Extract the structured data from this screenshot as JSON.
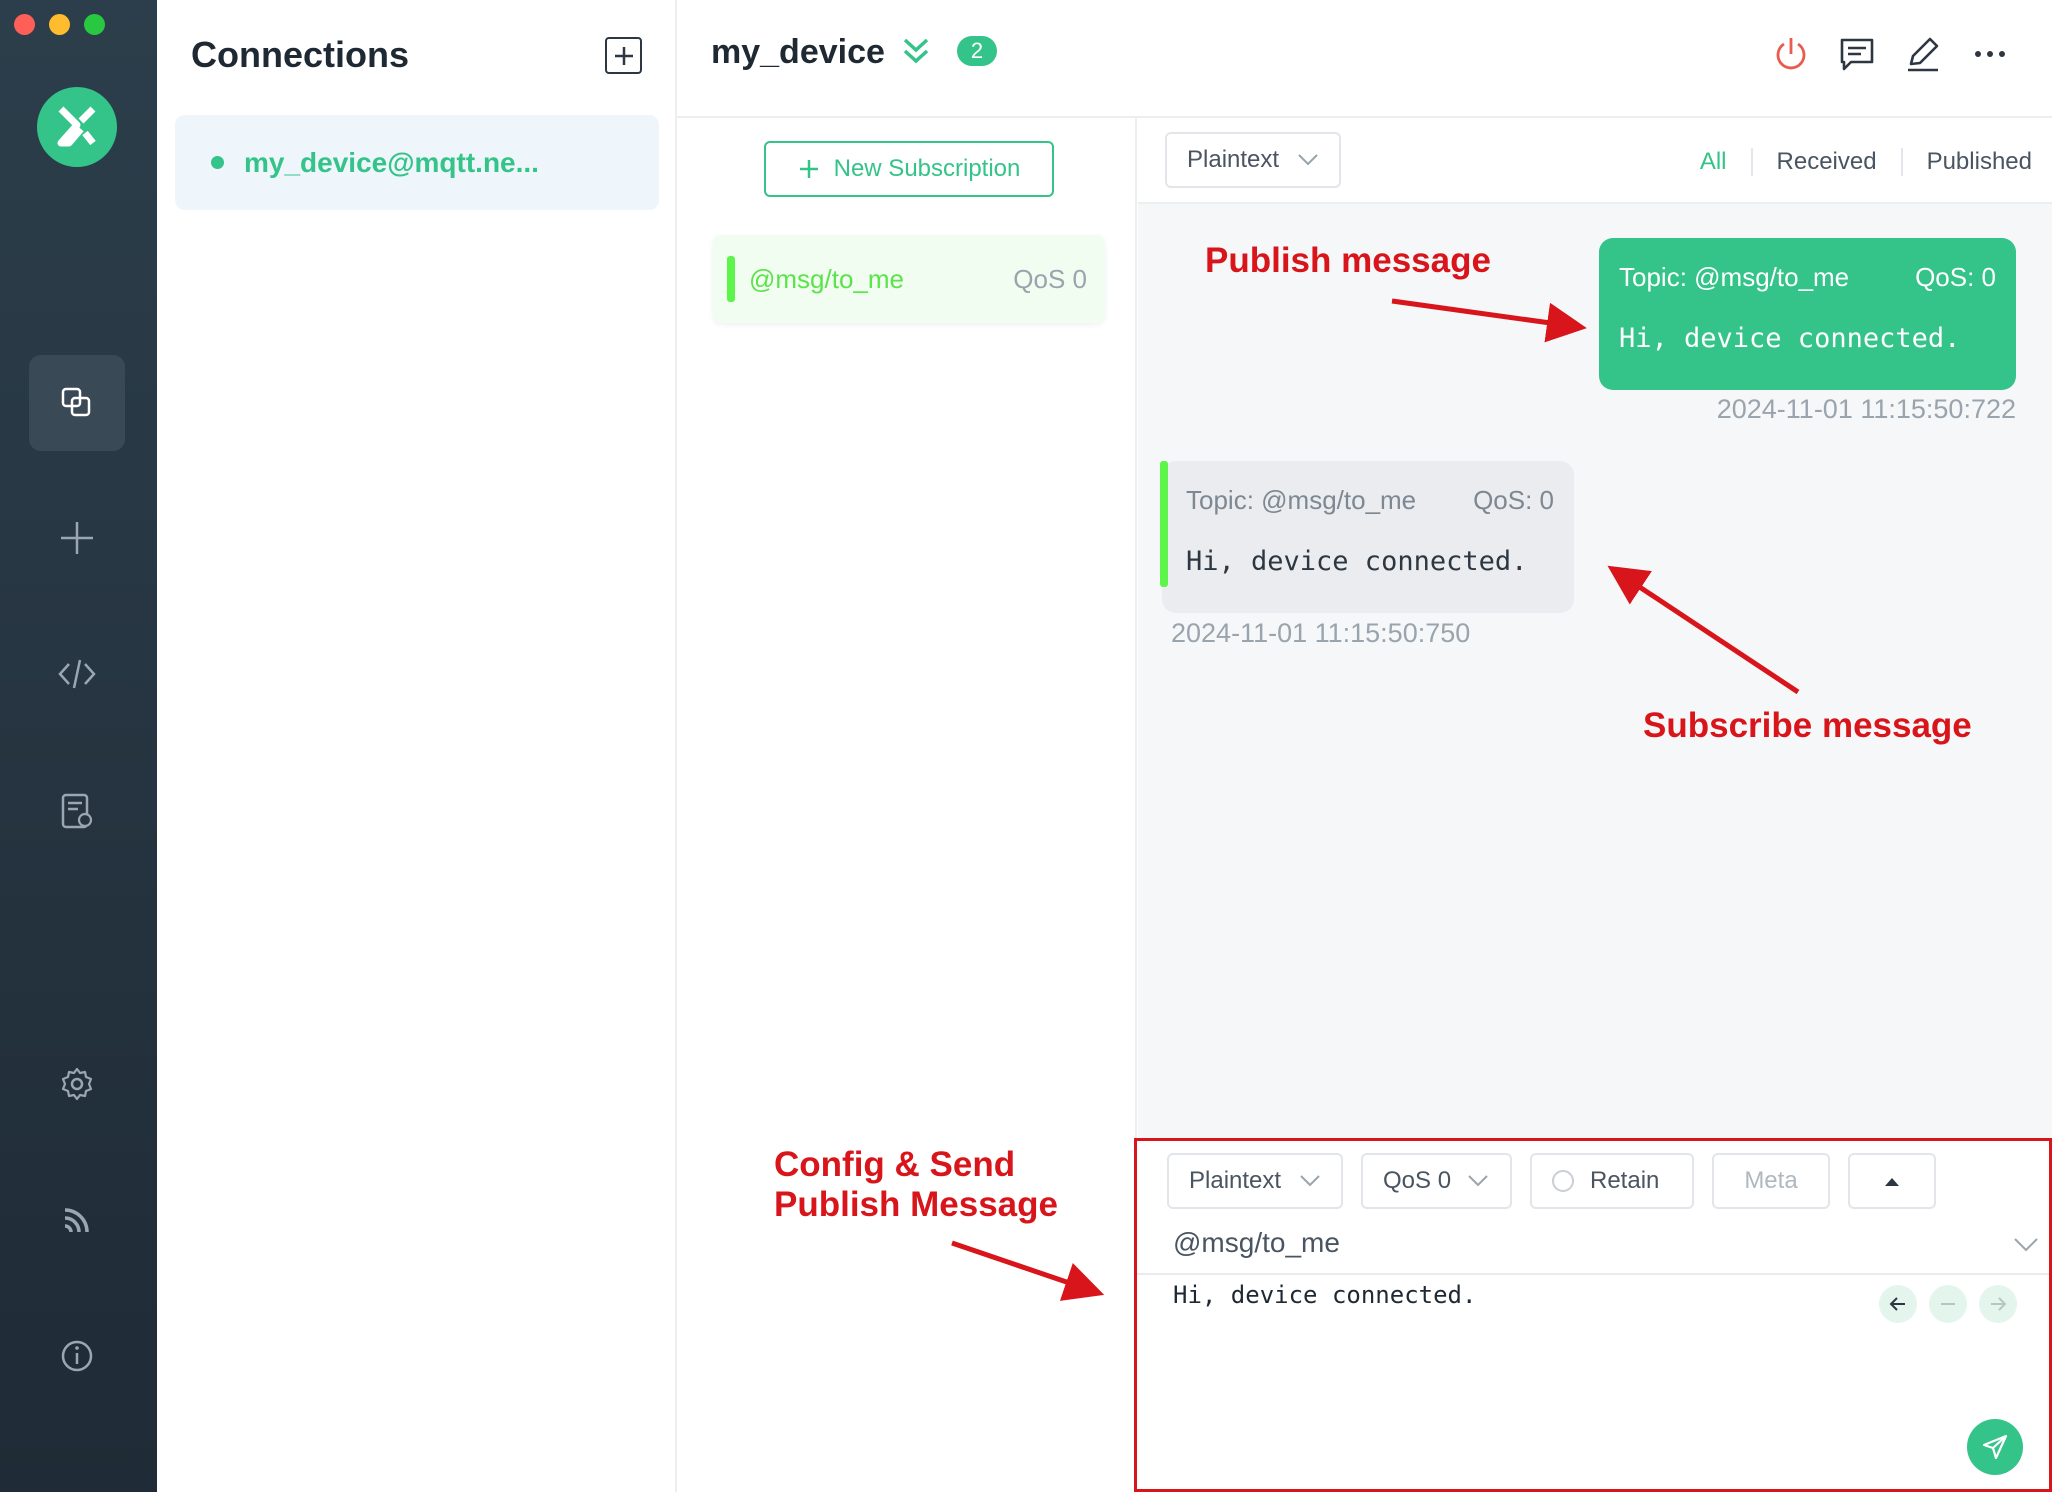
{
  "connections": {
    "title": "Connections",
    "items": [
      {
        "name": "my_device@mqtt.ne..."
      }
    ]
  },
  "header": {
    "device": "my_device",
    "badge": "2"
  },
  "subscriptions": {
    "new_label": "New Subscription",
    "items": [
      {
        "topic": "@msg/to_me",
        "qos": "QoS 0"
      }
    ]
  },
  "messages": {
    "format": "Plaintext",
    "filters": {
      "all": "All",
      "received": "Received",
      "published": "Published"
    },
    "published": {
      "topic": "Topic: @msg/to_me",
      "qos": "QoS: 0",
      "payload": "Hi, device connected.",
      "time": "2024-11-01 11:15:50:722"
    },
    "received": {
      "topic": "Topic: @msg/to_me",
      "qos": "QoS: 0",
      "payload": "Hi, device connected.",
      "time": "2024-11-01 11:15:50:750"
    }
  },
  "annotations": {
    "publish": "Publish message",
    "subscribe": "Subscribe message",
    "config_line1": "Config & Send",
    "config_line2": "Publish Message",
    "color": "#d8151a"
  },
  "publisher": {
    "format": "Plaintext",
    "qos": "QoS 0",
    "retain": "Retain",
    "meta": "Meta",
    "topic": "@msg/to_me",
    "payload": "Hi, device connected."
  },
  "colors": {
    "accent": "#34c388",
    "sub_bar": "#5df54a",
    "rail": "#26343f"
  }
}
